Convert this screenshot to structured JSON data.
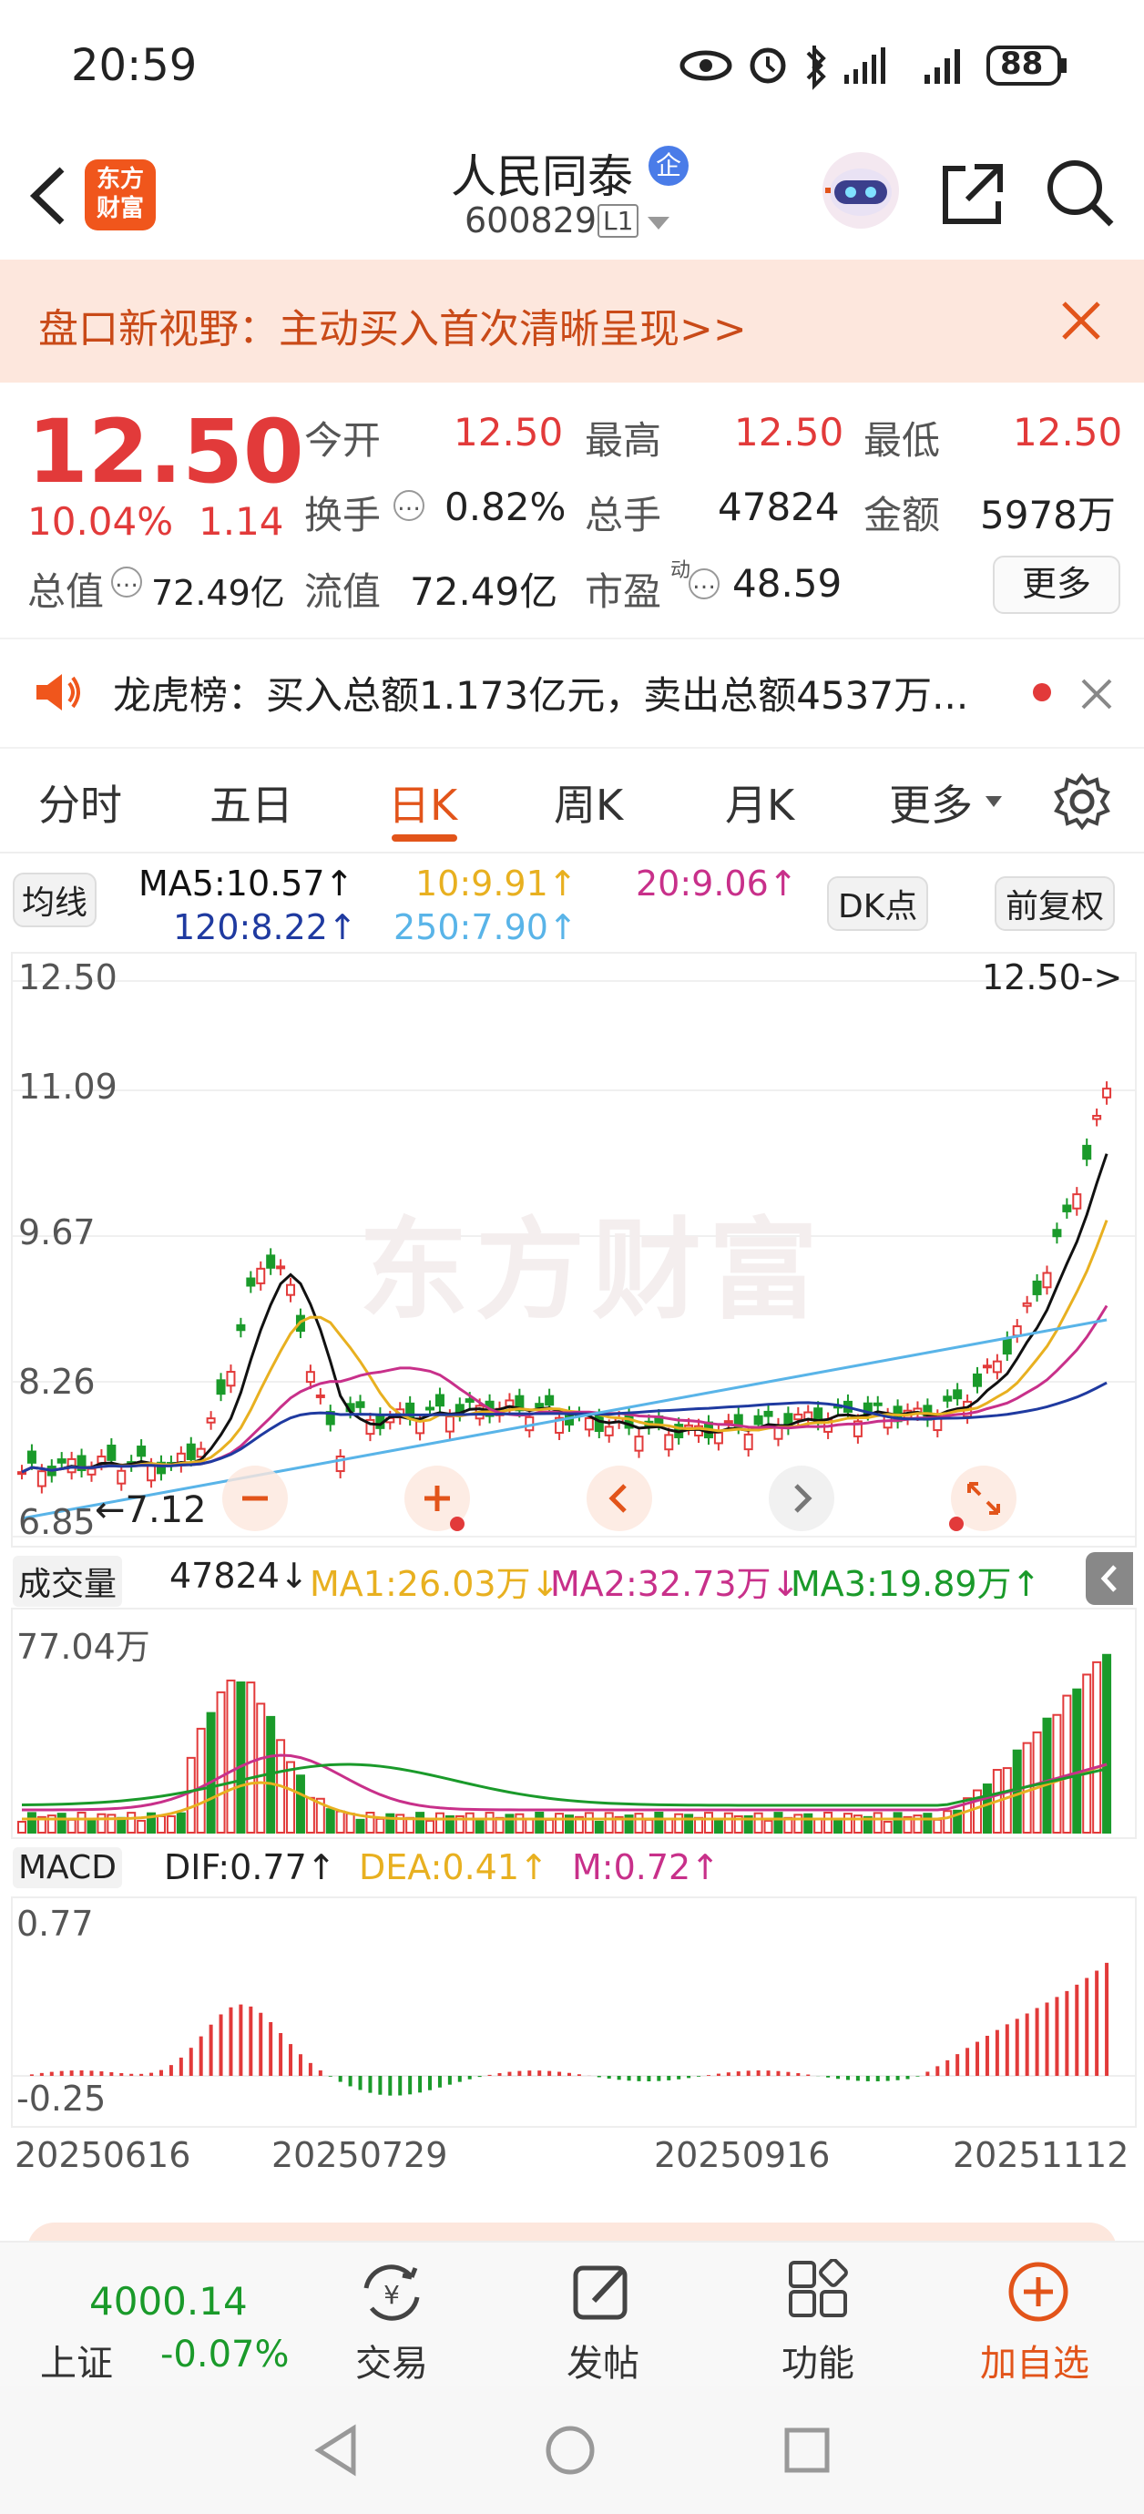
{
  "status": {
    "time": "20:59",
    "battery": "88"
  },
  "header": {
    "logo_text": "东方\n财富",
    "stock_name": "人民同泰",
    "badge": "企",
    "stock_code": "600829",
    "level": "L1"
  },
  "banner": {
    "text": "盘口新视野：主动买入首次清晰呈现>>"
  },
  "quote": {
    "price": "12.50",
    "change_pct": "10.04%",
    "change": "1.14",
    "open_label": "今开",
    "open": "12.50",
    "high_label": "最高",
    "high": "12.50",
    "low_label": "最低",
    "low": "12.50",
    "turnover_label": "换手",
    "turnover": "0.82%",
    "volume_label": "总手",
    "volume": "47824",
    "amount_label": "金额",
    "amount": "5978万",
    "mktcap_label": "总值",
    "mktcap": "72.49亿",
    "float_label": "流值",
    "float": "72.49亿",
    "pe_label": "市盈",
    "pe_sup": "动",
    "pe": "48.59",
    "more": "更多"
  },
  "notice": {
    "text": "龙虎榜：买入总额1.173亿元，卖出总额4537万..."
  },
  "tabs": [
    {
      "label": "分时"
    },
    {
      "label": "五日"
    },
    {
      "label": "日K"
    },
    {
      "label": "周K"
    },
    {
      "label": "月K"
    },
    {
      "label": "更多"
    }
  ],
  "ma_bar": {
    "selector": "均线",
    "ma5": "MA5:10.57↑",
    "ma10": "10:9.91↑",
    "ma20": "20:9.06↑",
    "ma120": "120:8.22↑",
    "ma250": "250:7.90↑",
    "dk": "DK点",
    "adjust": "前复权"
  },
  "price_chart": {
    "y_labels": [
      "12.50",
      "11.09",
      "9.67",
      "8.26",
      "6.85"
    ],
    "current_tag": "12.50->",
    "low_tag": "7.12",
    "watermark": "东方财富"
  },
  "volume_bar": {
    "selector": "成交量",
    "vol": "47824↓",
    "ma1": "MA1:26.03万↓",
    "ma2": "MA2:32.73万↓",
    "ma3": "MA3:19.89万↑",
    "max_label": "77.04万"
  },
  "macd_bar": {
    "selector": "MACD",
    "dif": "DIF:0.77↑",
    "dea": "DEA:0.41↑",
    "m": "M:0.72↑",
    "max_label": "0.77",
    "min_label": "-0.25"
  },
  "x_dates": [
    "20250616",
    "20250729",
    "20250916",
    "20251112"
  ],
  "footer": {
    "index_value": "4000.14",
    "index_name": "上证",
    "index_change": "-0.07%",
    "items": [
      {
        "label": "交易"
      },
      {
        "label": "发帖"
      },
      {
        "label": "功能"
      },
      {
        "label": "加自选"
      }
    ]
  },
  "colors": {
    "accent": "#e2541a",
    "up": "#e23a3a",
    "down": "#1a9a2a",
    "ma5": "#111111",
    "ma10": "#e8b020",
    "ma20": "#c8308a",
    "ma120": "#1f3aa0",
    "ma250": "#59b4e8"
  }
}
